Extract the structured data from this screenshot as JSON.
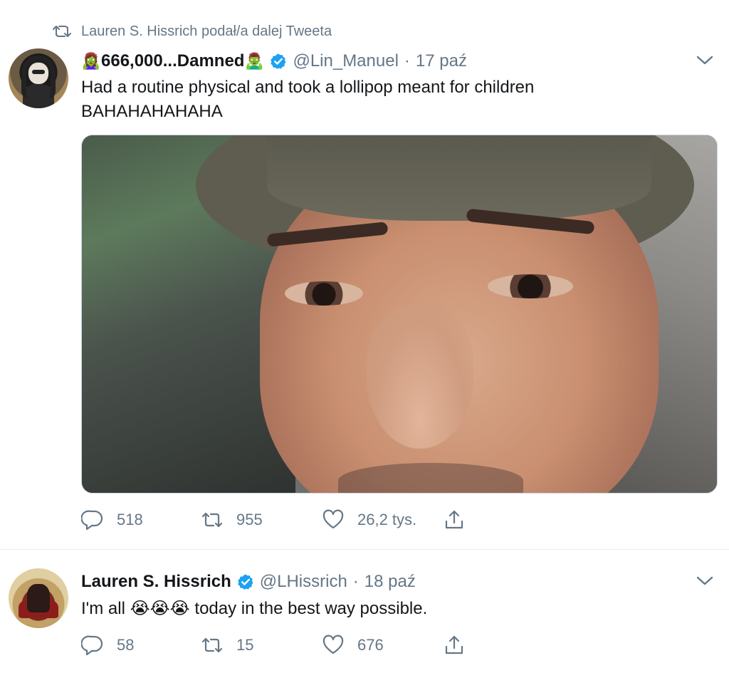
{
  "retweet_context": {
    "label": "Lauren S. Hissrich podał/a dalej Tweeta"
  },
  "tweets": [
    {
      "display_name": "666,000...Damned",
      "name_prefix_emoji": "🧟‍♀️",
      "name_suffix_emoji": "🧟‍♂️",
      "verified": true,
      "handle": "@Lin_Manuel",
      "separator": "·",
      "date": "17 paź",
      "text_line1": "Had a routine physical and took a lollipop meant for children",
      "text_line2": "BAHAHAHAHAHA",
      "has_media": true,
      "actions": {
        "replies": "518",
        "retweets": "955",
        "likes": "26,2 tys."
      }
    },
    {
      "display_name": "Lauren S. Hissrich",
      "verified": true,
      "handle": "@LHissrich",
      "separator": "·",
      "date": "18 paź",
      "text_before": "I'm all",
      "text_emojis": "😭😭😭",
      "text_after": "today in the best way possible.",
      "has_media": false,
      "actions": {
        "replies": "58",
        "retweets": "15",
        "likes": "676"
      }
    }
  ],
  "icons": {
    "retweet_context": "retweet-icon",
    "verified": "verified-badge-icon",
    "caret": "chevron-down-icon",
    "reply": "reply-icon",
    "retweet": "retweet-icon",
    "like": "heart-icon",
    "share": "share-icon"
  },
  "colors": {
    "secondary_text": "#657786",
    "verified_blue": "#1da1f2",
    "divider": "#e6ecf0"
  }
}
